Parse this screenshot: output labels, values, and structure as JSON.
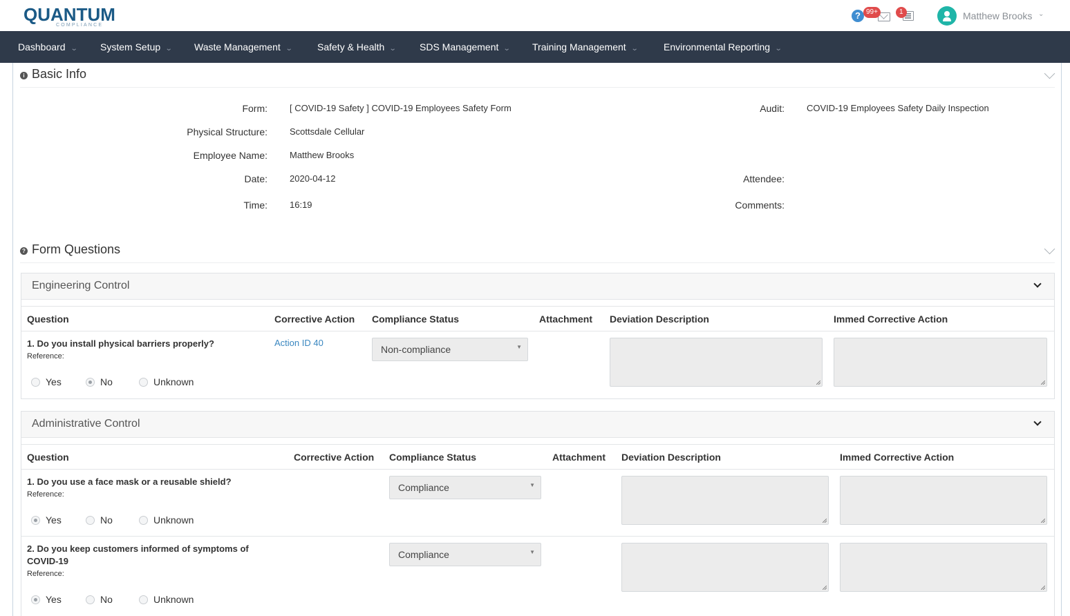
{
  "brand": {
    "name": "UANTUM",
    "initial": "Q",
    "sub": "COMPLIANCE"
  },
  "header": {
    "mail_badge": "99+",
    "news_badge": "1",
    "user_name": "Matthew Brooks"
  },
  "nav": [
    {
      "label": "Dashboard"
    },
    {
      "label": "System Setup"
    },
    {
      "label": "Waste Management"
    },
    {
      "label": "Safety & Health"
    },
    {
      "label": "SDS Management"
    },
    {
      "label": "Training Management"
    },
    {
      "label": "Environmental Reporting"
    }
  ],
  "basic_info": {
    "title": "Basic Info",
    "form_label": "Form:",
    "form_value": "[ COVID-19 Safety ] COVID-19 Employees Safety Form",
    "structure_label": "Physical Structure:",
    "structure_value": "Scottsdale Cellular",
    "employee_label": "Employee Name:",
    "employee_value": "Matthew Brooks",
    "date_label": "Date:",
    "date_value": "2020-04-12",
    "time_label": "Time:",
    "time_value": "16:19",
    "audit_label": "Audit:",
    "audit_value": "COVID-19 Employees Safety Daily Inspection",
    "attendee_label": "Attendee:",
    "comments_label": "Comments:"
  },
  "form_questions": {
    "title": "Form Questions",
    "columns": {
      "question": "Question",
      "corrective": "Corrective Action",
      "status": "Compliance Status",
      "attachment": "Attachment",
      "deviation": "Deviation Description",
      "immed": "Immed Corrective Action"
    },
    "radio_options": [
      "Yes",
      "No",
      "Unknown"
    ],
    "reference_label": "Reference:",
    "groups": [
      {
        "title": "Engineering Control",
        "questions": [
          {
            "text": "1. Do you install physical barriers properly?",
            "action": "Action ID 40",
            "status": "Non-compliance",
            "answer": "No"
          }
        ]
      },
      {
        "title": "Administrative Control",
        "questions": [
          {
            "text": "1. Do you use a face mask or a reusable shield?",
            "action": "",
            "status": "Compliance",
            "answer": "Yes"
          },
          {
            "text": "2. Do you keep customers informed of symptoms of COVID-19",
            "action": "",
            "status": "Compliance",
            "answer": "Yes"
          }
        ]
      }
    ]
  }
}
